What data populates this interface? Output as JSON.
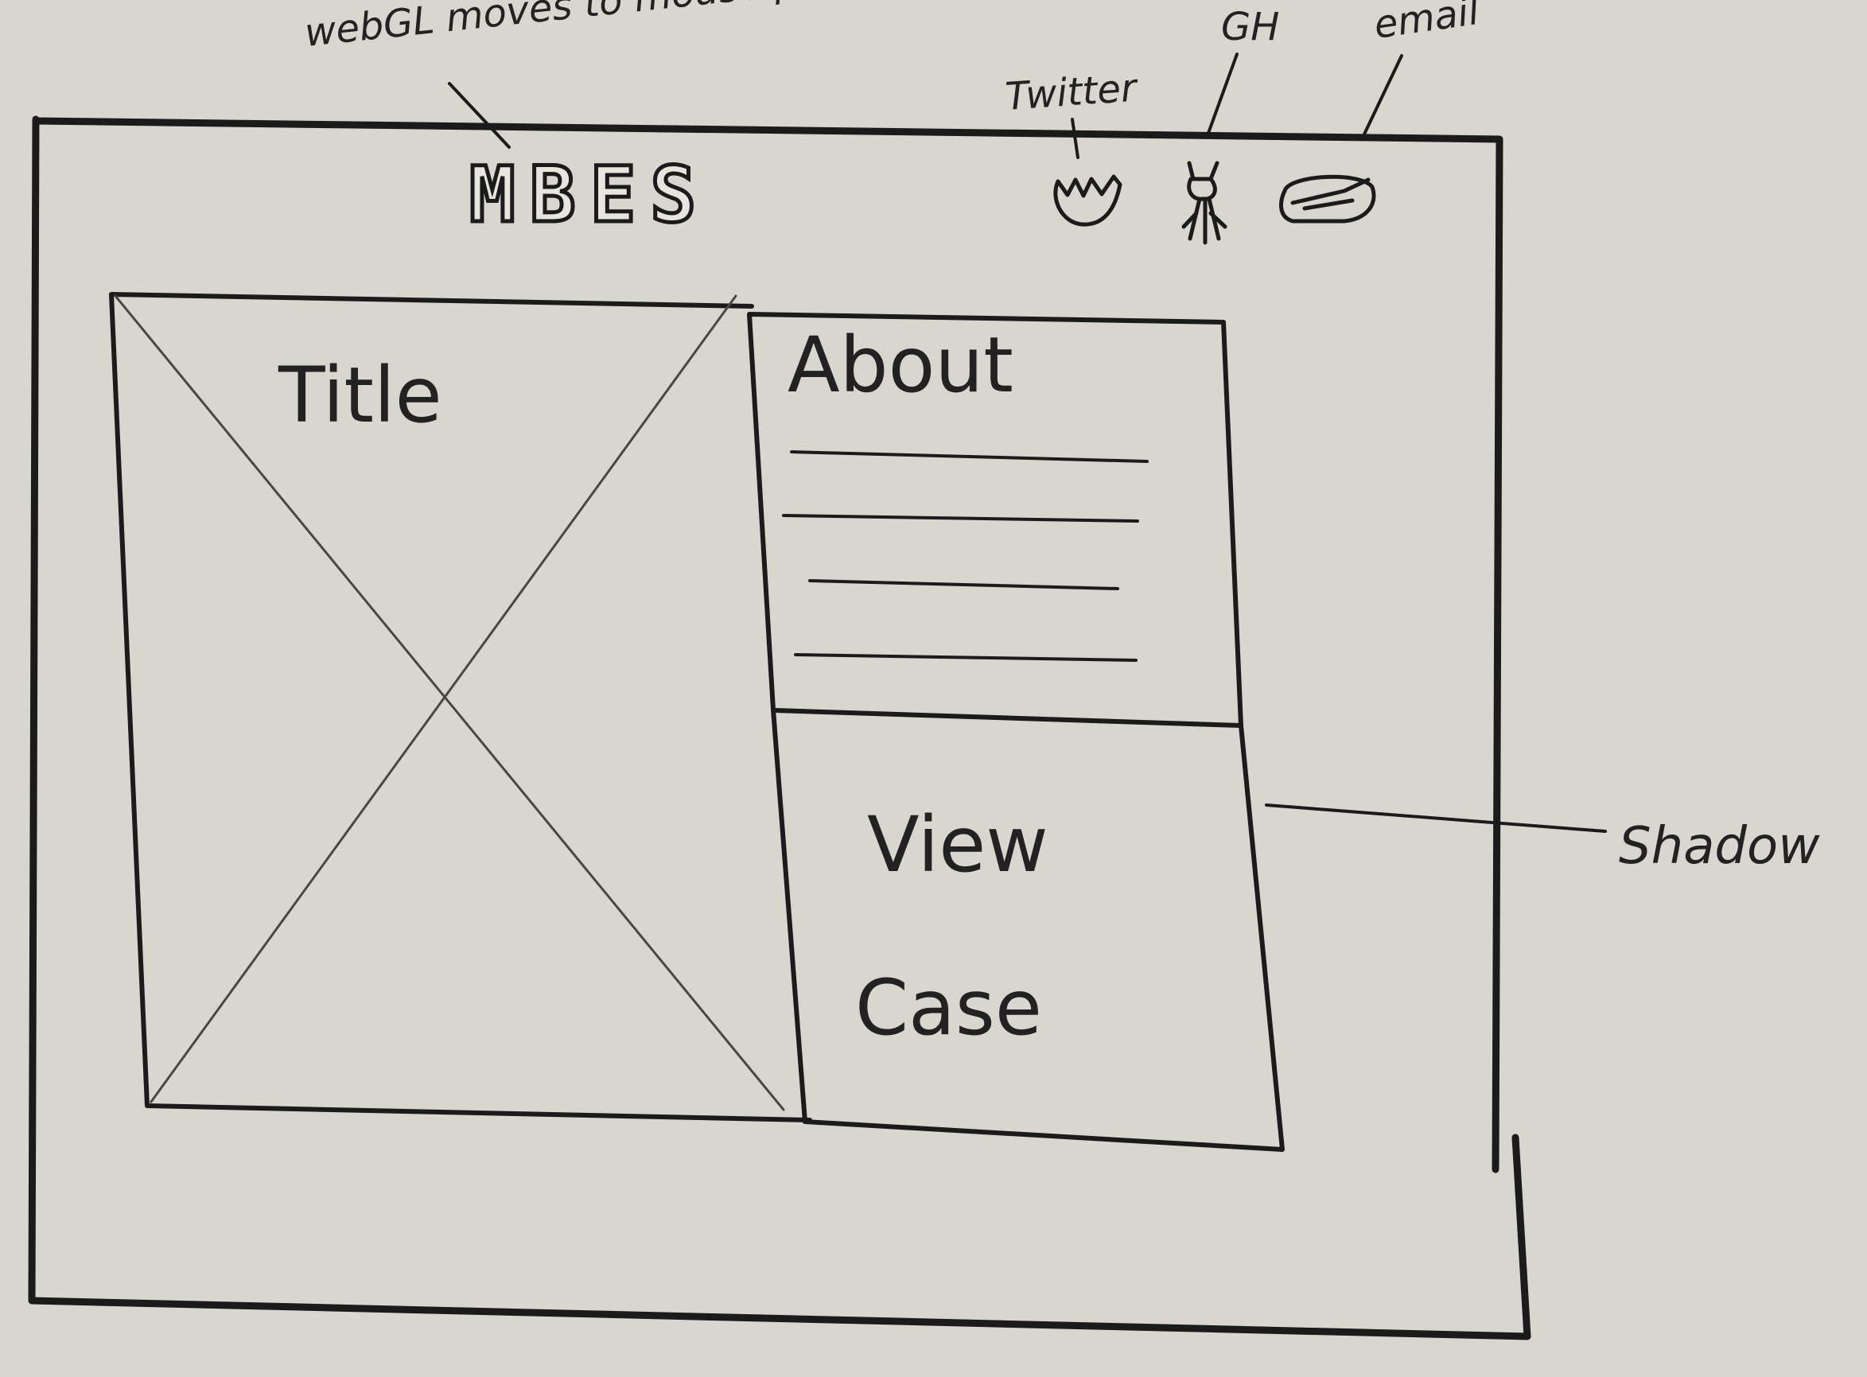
{
  "annotations": {
    "logo_note": "webGL moves to mouse pos",
    "twitter_note": "Twitter",
    "github_note": "GH",
    "email_note": "email",
    "shadow_note": "Shadow"
  },
  "header": {
    "logo_text": "MBES",
    "icons": [
      "twitter-icon",
      "github-icon",
      "email-icon"
    ]
  },
  "hero": {
    "title": "Title"
  },
  "about": {
    "heading": "About"
  },
  "case": {
    "line1": "View",
    "line2": "Case"
  },
  "colors": {
    "paper": "#d9d5cf",
    "ink": "#1b1b1b"
  }
}
